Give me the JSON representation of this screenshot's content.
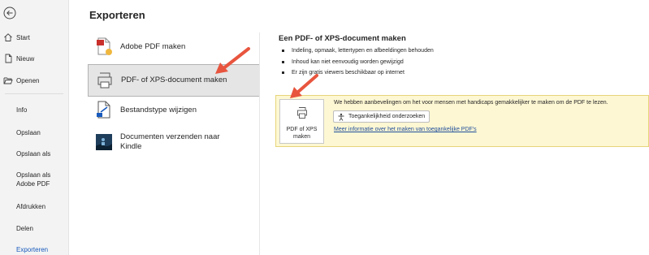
{
  "sidebar": {
    "items": [
      {
        "label": "Start",
        "icon": "home-icon"
      },
      {
        "label": "Nieuw",
        "icon": "new-document-icon"
      },
      {
        "label": "Openen",
        "icon": "folder-open-icon"
      },
      {
        "label": "Info"
      },
      {
        "label": "Opslaan"
      },
      {
        "label": "Opslaan als"
      },
      {
        "label": "Opslaan als Adobe PDF"
      },
      {
        "label": "Afdrukken"
      },
      {
        "label": "Delen"
      },
      {
        "label": "Exporteren"
      }
    ]
  },
  "main": {
    "title": "Exporteren",
    "options": [
      {
        "label": "Adobe PDF maken",
        "icon": "adobe-pdf-icon"
      },
      {
        "label": "PDF- of XPS-document maken",
        "icon": "pdf-xps-document-icon"
      },
      {
        "label": "Bestandstype wijzigen",
        "icon": "change-file-type-icon"
      },
      {
        "label": "Documenten verzenden naar Kindle",
        "icon": "kindle-icon"
      }
    ]
  },
  "detail": {
    "title": "Een PDF- of XPS-document maken",
    "bullets": [
      "Indeling, opmaak, lettertypen en afbeeldingen behouden",
      "Inhoud kan niet eenvoudig worden gewijzigd",
      "Er zijn gratis viewers beschikbaar op internet"
    ],
    "create_button": "PDF of XPS maken",
    "message": "We hebben aanbevelingen om het voor mensen met handicaps gemakkelijker te maken om de PDF te lezen.",
    "check_button": "Toegankelijkheid onderzoeken",
    "link": "Meer informatie over het maken van toegankelijke PDF's"
  },
  "colors": {
    "accent": "#185abd",
    "panel_bg": "#fdf7d3",
    "annotation_arrow": "#e8553e"
  }
}
